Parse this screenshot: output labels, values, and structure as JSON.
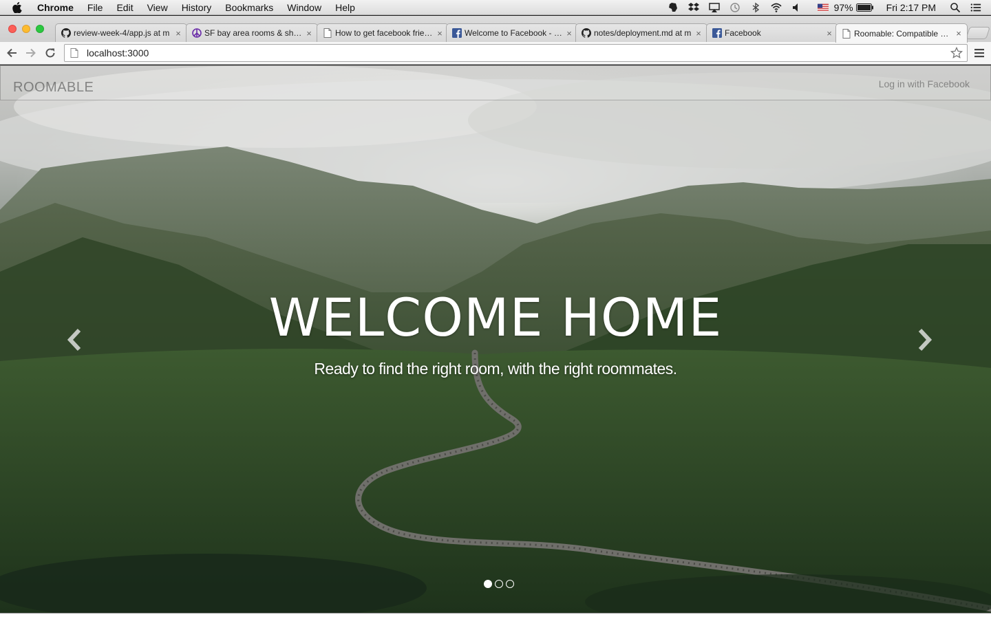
{
  "menubar": {
    "app_name": "Chrome",
    "items": [
      "File",
      "Edit",
      "View",
      "History",
      "Bookmarks",
      "Window",
      "Help"
    ],
    "battery": "97%",
    "clock": "Fri 2:17 PM",
    "status_icons": [
      "evernote-icon",
      "dropbox-icon",
      "airplay-icon",
      "time-machine-icon",
      "bluetooth-icon",
      "wifi-icon",
      "volume-icon",
      "flag-us-icon",
      "battery-icon",
      "spotlight-icon",
      "notification-center-icon"
    ]
  },
  "tabs": [
    {
      "title": "review-week-4/app.js at m",
      "icon": "github-icon"
    },
    {
      "title": "SF bay area rooms & shares",
      "icon": "craigslist-peace-icon"
    },
    {
      "title": "How to get facebook friends",
      "icon": "page-icon"
    },
    {
      "title": "Welcome to Facebook - Log",
      "icon": "facebook-icon"
    },
    {
      "title": "notes/deployment.md at m",
      "icon": "github-icon"
    },
    {
      "title": "Facebook",
      "icon": "facebook-icon"
    },
    {
      "title": "Roomable: Compatible Roo",
      "icon": "page-icon",
      "active": true
    }
  ],
  "toolbar": {
    "url": "localhost:3000"
  },
  "site": {
    "brand": "ROOMABLE",
    "login_link": "Log in with Facebook",
    "hero_title": "WELCOME HOME",
    "hero_subtitle": "Ready to find the right room, with the right roommates.",
    "carousel_slides": 3,
    "carousel_active": 1
  }
}
